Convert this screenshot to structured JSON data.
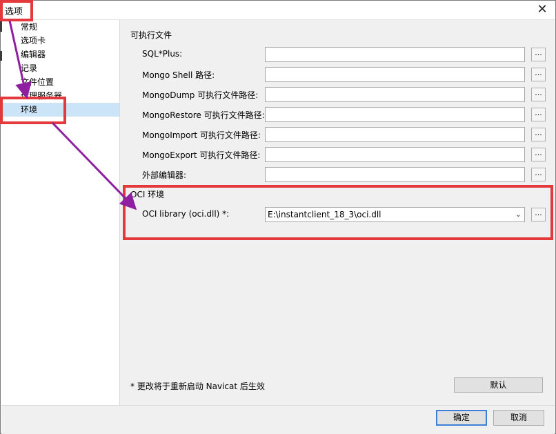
{
  "window": {
    "title": "选项",
    "close_glyph": "✕"
  },
  "sidebar": {
    "items": [
      {
        "label": "常规"
      },
      {
        "label": "选项卡"
      },
      {
        "label": "编辑器"
      },
      {
        "label": "记录"
      },
      {
        "label": "文件位置"
      },
      {
        "label": "代理服务器"
      },
      {
        "label": "环境",
        "selected": true
      }
    ]
  },
  "executables": {
    "group_title": "可执行文件",
    "rows": [
      {
        "label": "SQL*Plus:",
        "value": ""
      },
      {
        "label": "Mongo Shell 路径:",
        "value": ""
      },
      {
        "label": "MongoDump 可执行文件路径:",
        "value": ""
      },
      {
        "label": "MongoRestore 可执行文件路径:",
        "value": ""
      },
      {
        "label": "MongoImport 可执行文件路径:",
        "value": ""
      },
      {
        "label": "MongoExport 可执行文件路径:",
        "value": ""
      },
      {
        "label": "外部编辑器:",
        "value": ""
      }
    ],
    "browse_label": "..."
  },
  "oci": {
    "group_title": "OCI 环境",
    "label": "OCI library (oci.dll) *:",
    "value": "E:\\instantclient_18_3\\oci.dll",
    "browse_label": "..."
  },
  "note": "* 更改将于重新启动 Navicat 后生效",
  "buttons": {
    "default": "默认",
    "ok": "确定",
    "cancel": "取消"
  },
  "annotation": {
    "highlight_color": "#e4393c",
    "arrow_color": "#8e1fa0"
  }
}
